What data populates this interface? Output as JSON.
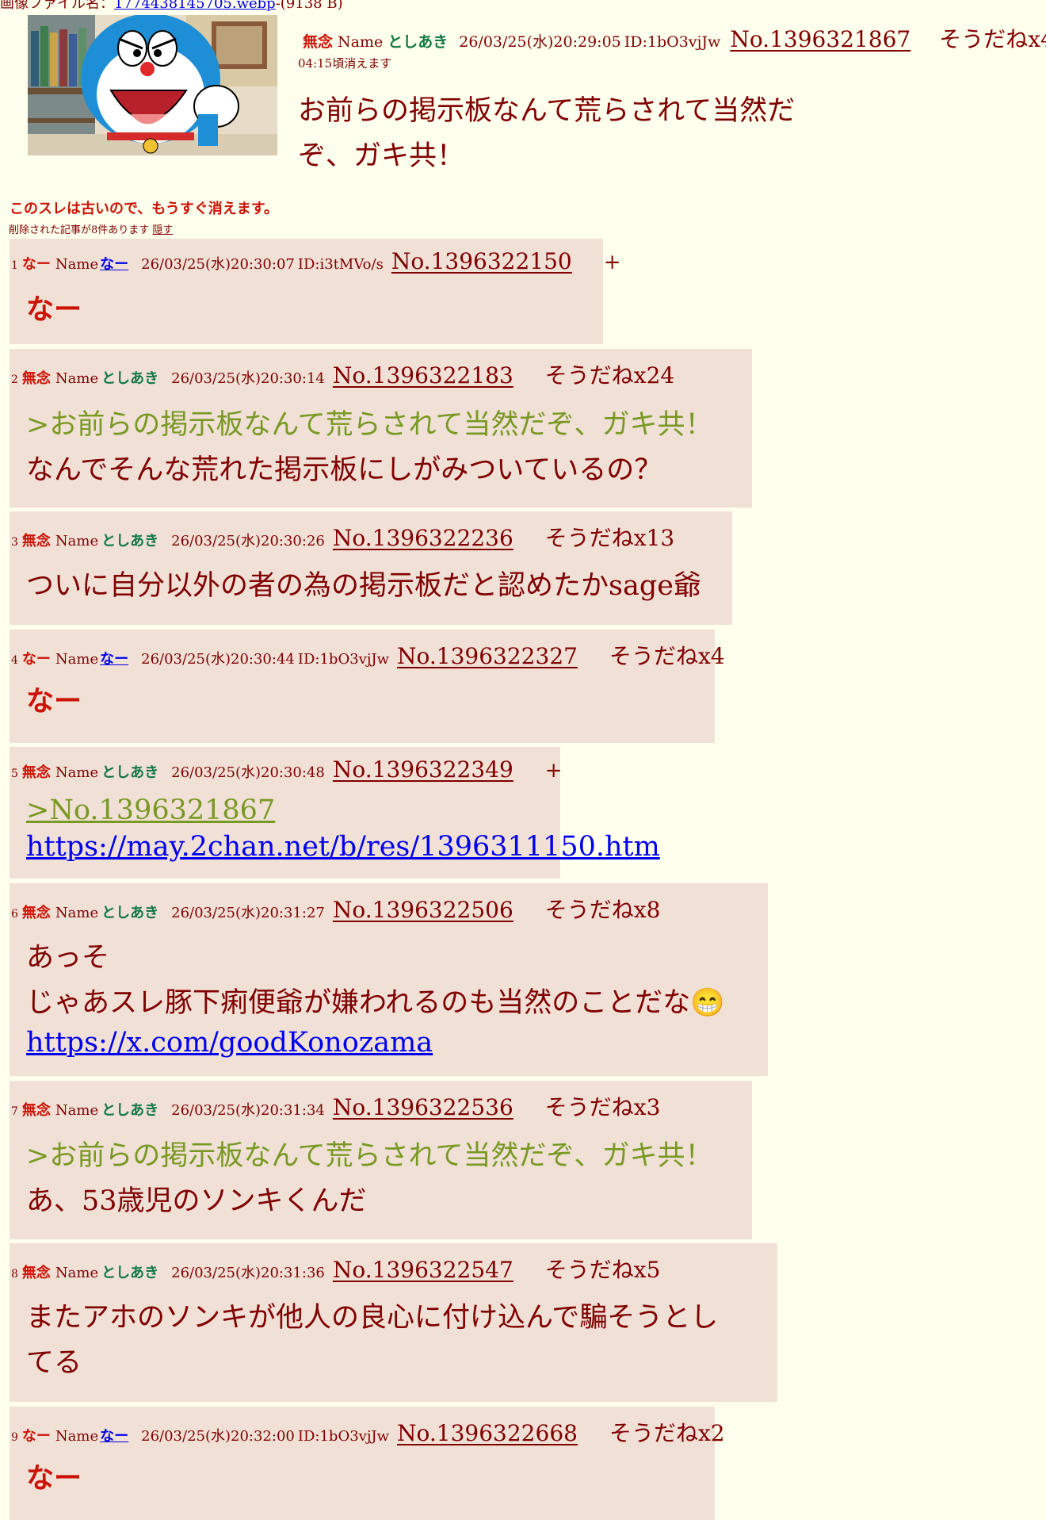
{
  "file": {
    "label": "画像ファイル名：",
    "name": "1774438145705.webp",
    "size": "-(9138 B)"
  },
  "thumbnail": {
    "alt": "ドラえもん"
  },
  "op": {
    "subject": "無念",
    "name_label": "Name",
    "name": "としあき",
    "date": "26/03/25(水)20:29:05",
    "id": "ID:1bO3vjJw",
    "no": "No.1396321867",
    "sodane": "そうだねx4",
    "expire": "04:15頃消えます",
    "line1": "お前らの掲示板なんて荒らされて当然だ",
    "line2": "ぞ、ガキ共！"
  },
  "notice": {
    "old": "このスレは古いので、もうすぐ消えます。",
    "deleted": "削除された記事が8件あります",
    "hide": "隠す"
  },
  "replies": [
    {
      "num": "1",
      "subject": "なー",
      "name_label": "Name",
      "mail": "なー",
      "date": "26/03/25(水)20:30:07",
      "id": "ID:i3tMVo/s",
      "no": "No.1396322150",
      "plus": "+",
      "body1": "なー"
    },
    {
      "num": "2",
      "subject": "無念",
      "name_label": "Name",
      "name": "としあき",
      "date": "26/03/25(水)20:30:14",
      "no": "No.1396322183",
      "sodane": "そうだねx24",
      "quote": ">お前らの掲示板なんて荒らされて当然だぞ、ガキ共！",
      "body1": "なんでそんな荒れた掲示板にしがみついているの？"
    },
    {
      "num": "3",
      "subject": "無念",
      "name_label": "Name",
      "name": "としあき",
      "date": "26/03/25(水)20:30:26",
      "no": "No.1396322236",
      "sodane": "そうだねx13",
      "body1": "ついに自分以外の者の為の掲示板だと認めたかsage爺"
    },
    {
      "num": "4",
      "subject": "なー",
      "name_label": "Name",
      "mail": "なー",
      "date": "26/03/25(水)20:30:44",
      "id": "ID:1bO3vjJw",
      "no": "No.1396322327",
      "sodane": "そうだねx4",
      "body1": "なー"
    },
    {
      "num": "5",
      "subject": "無念",
      "name_label": "Name",
      "name": "としあき",
      "date": "26/03/25(水)20:30:48",
      "no": "No.1396322349",
      "plus": "+",
      "quote": ">No.1396321867",
      "link": "https://may.2chan.net/b/res/1396311150.htm"
    },
    {
      "num": "6",
      "subject": "無念",
      "name_label": "Name",
      "name": "としあき",
      "date": "26/03/25(水)20:31:27",
      "no": "No.1396322506",
      "sodane": "そうだねx8",
      "body1": "あっそ",
      "body2": "じゃあスレ豚下痢便爺が嫌われるのも当然のことだな😁",
      "link": "https://x.com/goodKonozama"
    },
    {
      "num": "7",
      "subject": "無念",
      "name_label": "Name",
      "name": "としあき",
      "date": "26/03/25(水)20:31:34",
      "no": "No.1396322536",
      "sodane": "そうだねx3",
      "quote": ">お前らの掲示板なんて荒らされて当然だぞ、ガキ共！",
      "body1": "あ、53歳児のソンキくんだ"
    },
    {
      "num": "8",
      "subject": "無念",
      "name_label": "Name",
      "name": "としあき",
      "date": "26/03/25(水)20:31:36",
      "no": "No.1396322547",
      "sodane": "そうだねx5",
      "body1": "またアホのソンキが他人の良心に付け込んで騙そうとし",
      "body2": "てる"
    },
    {
      "num": "9",
      "subject": "なー",
      "name_label": "Name",
      "mail": "なー",
      "date": "26/03/25(水)20:32:00",
      "id": "ID:1bO3vjJw",
      "no": "No.1396322668",
      "sodane": "そうだねx2",
      "body1": "なー"
    }
  ]
}
